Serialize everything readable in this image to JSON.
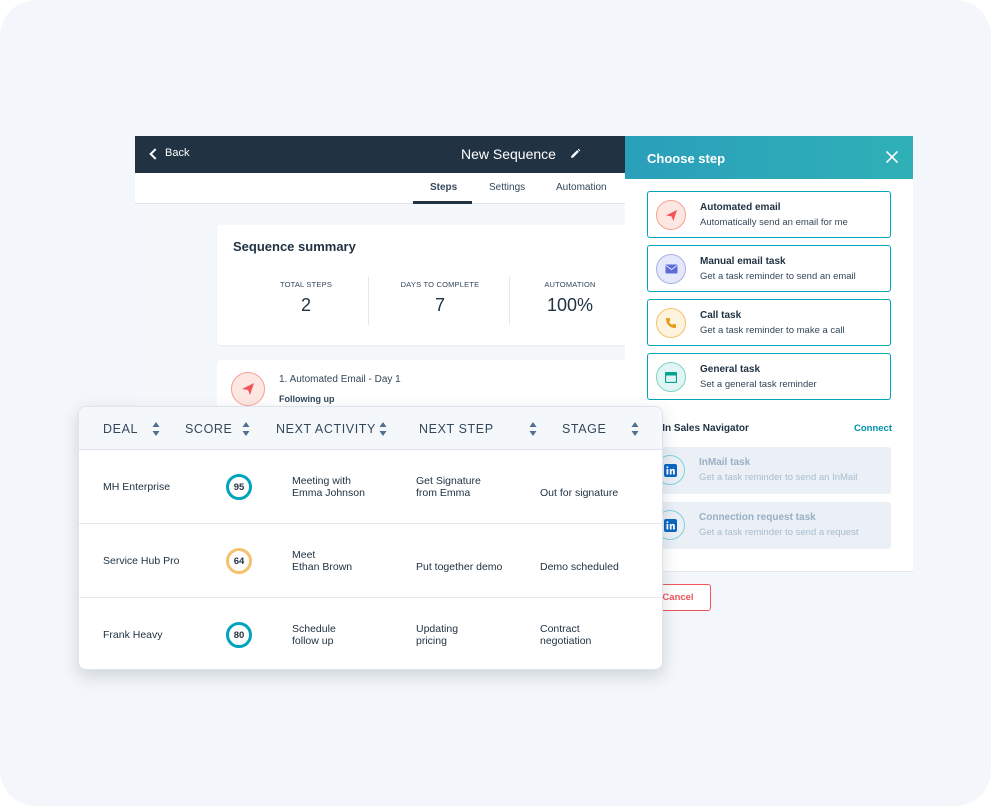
{
  "editor": {
    "back_label": "Back",
    "title": "New Sequence",
    "tabs": {
      "steps": "Steps",
      "settings": "Settings",
      "automation": "Automation"
    },
    "summary": {
      "title": "Sequence summary",
      "stats": [
        {
          "label": "TOTAL STEPS",
          "value": "2"
        },
        {
          "label": "DAYS TO COMPLETE",
          "value": "7"
        },
        {
          "label": "AUTOMATION",
          "value": "100%"
        }
      ]
    },
    "step": {
      "title": "1. Automated Email - Day 1",
      "subtitle": "Following up"
    }
  },
  "panel": {
    "title": "Choose step",
    "options": [
      {
        "title": "Automated email",
        "desc": "Automatically send an email for me",
        "icon": "paper-plane-icon"
      },
      {
        "title": "Manual email task",
        "desc": "Get a task reminder to send an email",
        "icon": "envelope-icon"
      },
      {
        "title": "Call task",
        "desc": "Get a task reminder to make a call",
        "icon": "phone-icon"
      },
      {
        "title": "General task",
        "desc": "Set a general task reminder",
        "icon": "task-icon"
      }
    ],
    "linkedin": {
      "heading": "kedIn Sales Navigator",
      "connect": "Connect",
      "options": [
        {
          "title": "InMail task",
          "desc": "Get a task reminder to send an InMail"
        },
        {
          "title": "Connection request task",
          "desc": "Get a task reminder to send a request"
        }
      ]
    },
    "cancel": "Cancel"
  },
  "deals": {
    "columns": {
      "deal": "DEAL",
      "score": "SCORE",
      "next_activity": "NEXT ACTIVITY",
      "next_step": "NEXT STEP",
      "stage": "STAGE"
    },
    "rows": [
      {
        "deal": "MH Enterprise",
        "score": "95",
        "score_color": "#00a4bd",
        "activity": [
          "Meeting with",
          "Emma Johnson"
        ],
        "next_step": [
          "Get Signature",
          "from Emma"
        ],
        "stage": [
          "Out for signature"
        ]
      },
      {
        "deal": "Service Hub Pro",
        "score": "64",
        "score_color": "#f5c26b",
        "activity": [
          "Meet",
          "Ethan Brown"
        ],
        "next_step": [
          "Put together demo"
        ],
        "stage": [
          "Demo scheduled"
        ]
      },
      {
        "deal": "Frank Heavy",
        "score": "80",
        "score_color": "#00a4bd",
        "activity": [
          "Schedule",
          "follow up"
        ],
        "next_step": [
          "Updating",
          "pricing"
        ],
        "stage": [
          "Contract",
          "negotiation"
        ]
      }
    ]
  },
  "colors": {
    "navy": "#213343",
    "teal": "#00a4bd",
    "coral": "#f2545b",
    "amber": "#f5c26b"
  }
}
